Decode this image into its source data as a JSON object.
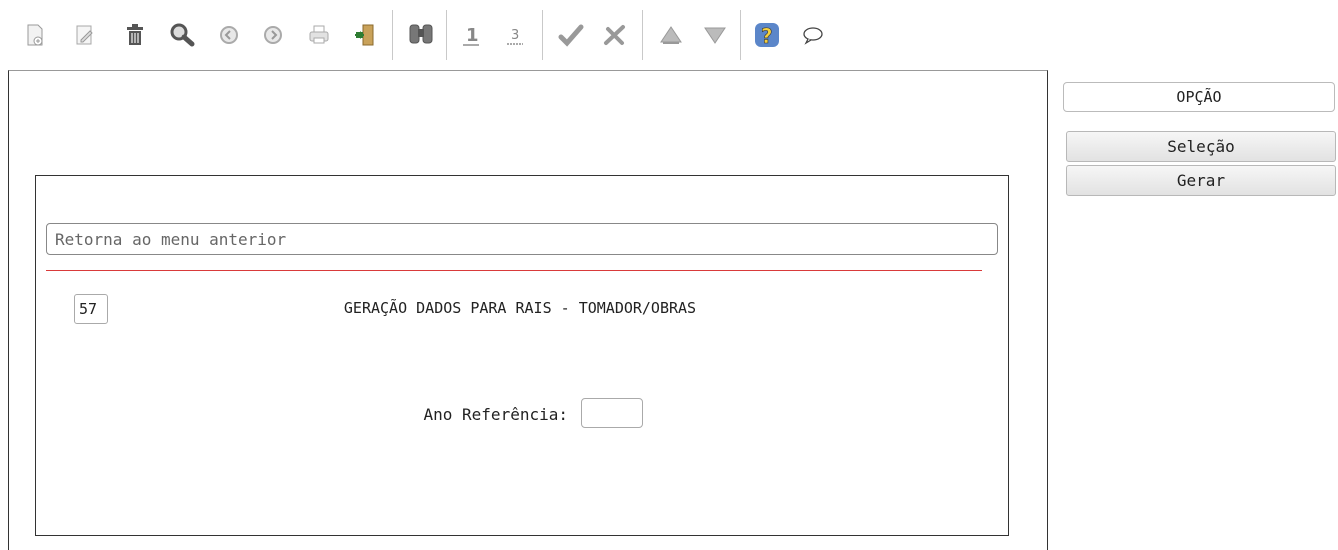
{
  "toolbar": {
    "icons": [
      "new-document-icon",
      "edit-icon",
      "trash-icon",
      "search-icon",
      "previous-icon",
      "next-icon",
      "print-icon",
      "exit-icon",
      "find-icon",
      "first-record-icon",
      "last-record-icon",
      "confirm-icon",
      "cancel-icon",
      "up-icon",
      "down-icon",
      "help-icon",
      "comment-icon"
    ]
  },
  "form": {
    "back_placeholder": "Retorna ao menu anterior",
    "program_code": "57",
    "title": "GERAÇÃO DADOS PARA RAIS - TOMADOR/OBRAS",
    "ano_label": "Ano Referência:",
    "ano_value": ""
  },
  "side": {
    "option_label": "OPÇÃO",
    "buttons": [
      "Seleção",
      "Gerar"
    ]
  }
}
